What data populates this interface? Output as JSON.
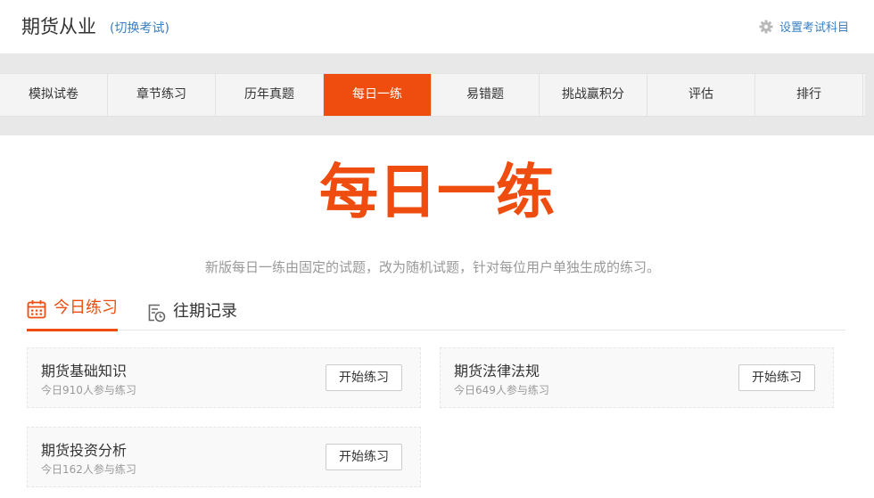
{
  "header": {
    "exam_title": "期货从业",
    "switch_label": "(切换考试)",
    "settings_label": "设置考试科目"
  },
  "nav": {
    "tabs": [
      {
        "label": "模拟试卷"
      },
      {
        "label": "章节练习"
      },
      {
        "label": "历年真题"
      },
      {
        "label": "每日一练",
        "active": true
      },
      {
        "label": "易错题"
      },
      {
        "label": "挑战赢积分"
      },
      {
        "label": "评估"
      },
      {
        "label": "排行"
      }
    ]
  },
  "hero": {
    "title": "每日一练",
    "subtitle": "新版每日一练由固定的试题，改为随机试题，针对每位用户单独生成的练习。"
  },
  "subtabs": {
    "today": "今日练习",
    "history": "往期记录"
  },
  "practice": [
    {
      "name": "期货基础知识",
      "count": "今日910人参与练习",
      "button": "开始练习"
    },
    {
      "name": "期货法律法规",
      "count": "今日649人参与练习",
      "button": "开始练习"
    },
    {
      "name": "期货投资分析",
      "count": "今日162人参与练习",
      "button": "开始练习"
    }
  ],
  "colors": {
    "accent": "#ee4d0f",
    "link": "#3a7fc2"
  },
  "icons": {
    "settings": "gear-icon",
    "today_tab": "calendar-icon",
    "history_tab": "history-record-icon"
  }
}
